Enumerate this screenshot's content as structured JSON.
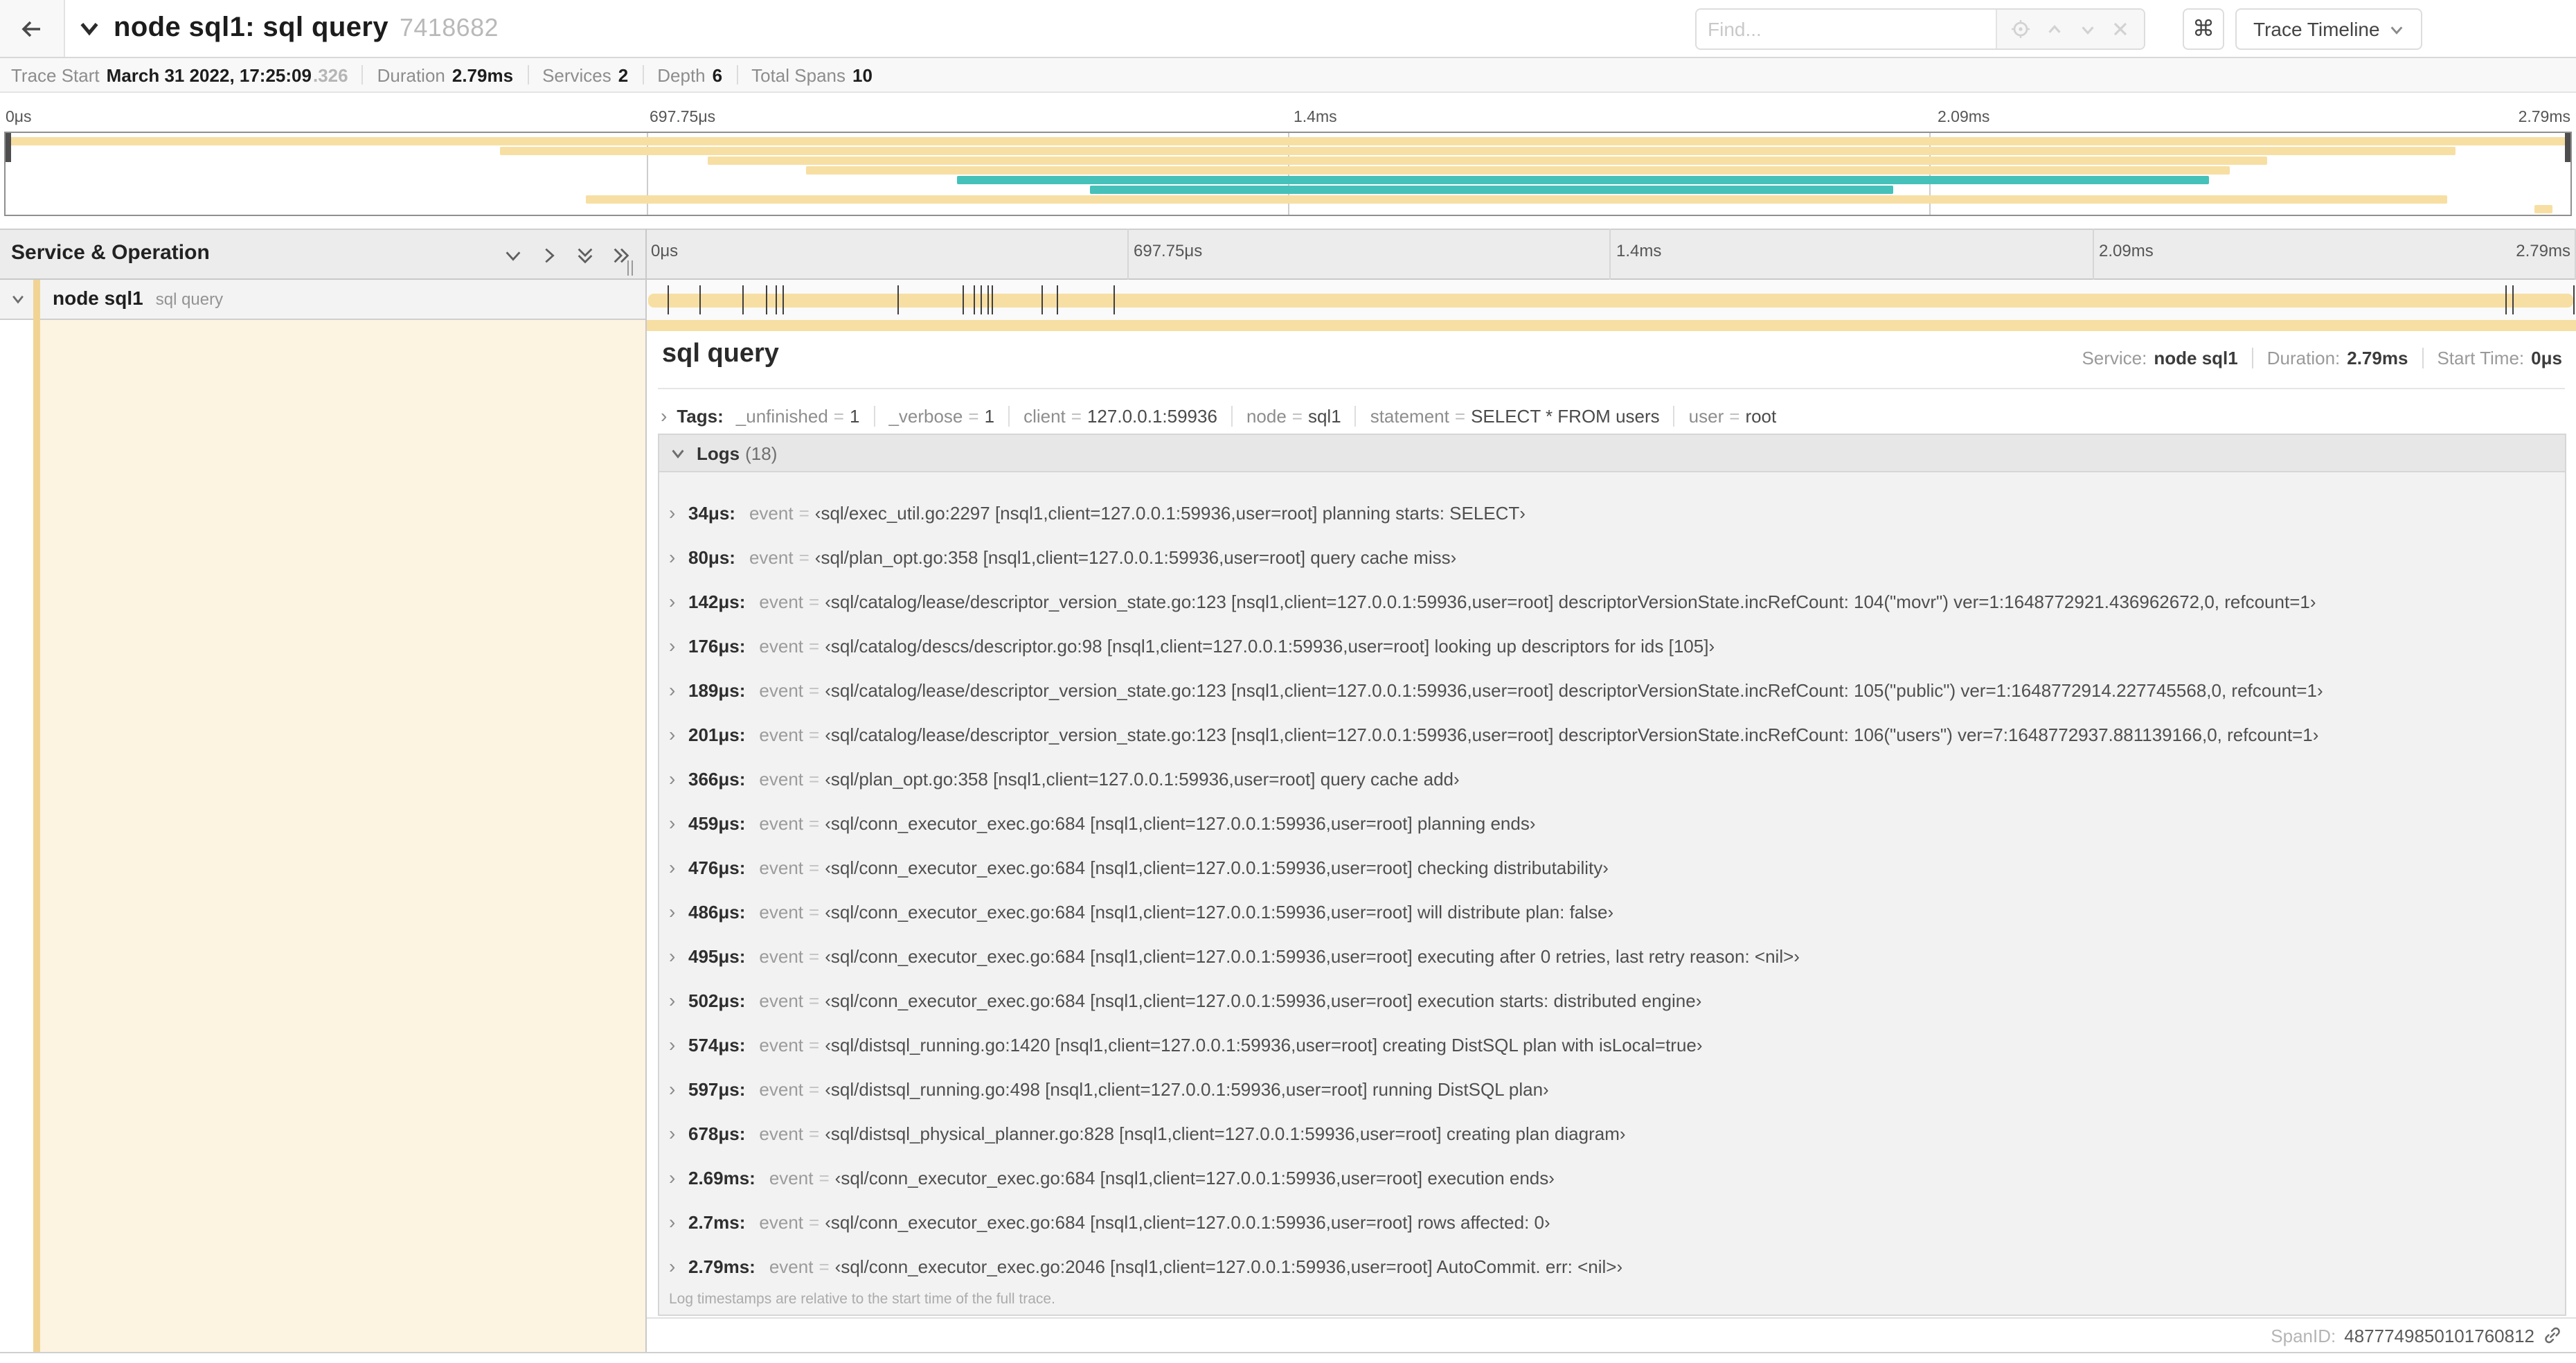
{
  "colors": {
    "span_tan": "#f7dfa3",
    "accent_tan": "#f1d494",
    "flow_teal": "#45c1ba",
    "left_column_cream": "#fcf3e1"
  },
  "header": {
    "title": "node sql1: sql query",
    "trace_id": "7418682",
    "find_placeholder": "Find...",
    "shortcut_key": "⌘",
    "view_button": "Trace Timeline"
  },
  "trace_info": {
    "items": [
      {
        "label": "Trace Start",
        "value": "March 31 2022, 17:25:09",
        "suffix": ".326"
      },
      {
        "label": "Duration",
        "value": "2.79ms"
      },
      {
        "label": "Services",
        "value": "2"
      },
      {
        "label": "Depth",
        "value": "6"
      },
      {
        "label": "Total Spans",
        "value": "10"
      }
    ]
  },
  "ruler": {
    "ticks": [
      {
        "label": "0μs",
        "pct": 0
      },
      {
        "label": "697.75μs",
        "pct": 25
      },
      {
        "label": "1.4ms",
        "pct": 50
      },
      {
        "label": "2.09ms",
        "pct": 75
      },
      {
        "label": "2.79ms",
        "pct": 100
      }
    ]
  },
  "minimap": {
    "bars": [
      {
        "row": 0,
        "start": 0,
        "end": 100,
        "color": "span_tan"
      },
      {
        "row": 1,
        "start": 19.3,
        "end": 95.5,
        "color": "span_tan"
      },
      {
        "row": 2,
        "start": 27.4,
        "end": 88.2,
        "color": "span_tan"
      },
      {
        "row": 3,
        "start": 31.2,
        "end": 86.7,
        "color": "span_tan"
      },
      {
        "row": 4,
        "start": 37.1,
        "end": 85.9,
        "color": "flow_teal"
      },
      {
        "row": 5,
        "start": 42.3,
        "end": 73.6,
        "color": "flow_teal"
      },
      {
        "row": 6,
        "start": 22.6,
        "end": 95.2,
        "color": "span_tan"
      },
      {
        "row": 7,
        "start": 98.6,
        "end": 99.3,
        "color": "span_tan"
      }
    ]
  },
  "timeline_header": {
    "label": "Service & Operation"
  },
  "span_row": {
    "service": "node sql1",
    "operation": "sql query",
    "tick_pcts": [
      1.2,
      2.9,
      5.1,
      6.3,
      6.8,
      7.2,
      13.1,
      16.5,
      17.1,
      17.4,
      17.8,
      18.0,
      20.6,
      21.4,
      24.3,
      96.4,
      96.8,
      99.93
    ]
  },
  "detail": {
    "title": "sql query",
    "summary": [
      {
        "label": "Service:",
        "value": "node sql1"
      },
      {
        "label": "Duration:",
        "value": "2.79ms"
      },
      {
        "label": "Start Time:",
        "value": "0μs"
      }
    ],
    "tags": {
      "label": "Tags:",
      "items": [
        {
          "key": "_unfinished",
          "value": "1"
        },
        {
          "key": "_verbose",
          "value": "1"
        },
        {
          "key": "client",
          "value": "127.0.0.1:59936"
        },
        {
          "key": "node",
          "value": "sql1"
        },
        {
          "key": "statement",
          "value": "SELECT * FROM users"
        },
        {
          "key": "user",
          "value": "root"
        }
      ]
    },
    "logs": {
      "label": "Logs",
      "count": "(18)",
      "field_key": "event",
      "entries": [
        {
          "t": "34μs:",
          "v": "‹sql/exec_util.go:2297 [nsql1,client=127.0.0.1:59936,user=root] planning starts: SELECT›"
        },
        {
          "t": "80μs:",
          "v": "‹sql/plan_opt.go:358 [nsql1,client=127.0.0.1:59936,user=root] query cache miss›"
        },
        {
          "t": "142μs:",
          "v": "‹sql/catalog/lease/descriptor_version_state.go:123 [nsql1,client=127.0.0.1:59936,user=root] descriptorVersionState.incRefCount: 104(\"movr\") ver=1:1648772921.436962672,0, refcount=1›"
        },
        {
          "t": "176μs:",
          "v": "‹sql/catalog/descs/descriptor.go:98 [nsql1,client=127.0.0.1:59936,user=root] looking up descriptors for ids [105]›"
        },
        {
          "t": "189μs:",
          "v": "‹sql/catalog/lease/descriptor_version_state.go:123 [nsql1,client=127.0.0.1:59936,user=root] descriptorVersionState.incRefCount: 105(\"public\") ver=1:1648772914.227745568,0, refcount=1›"
        },
        {
          "t": "201μs:",
          "v": "‹sql/catalog/lease/descriptor_version_state.go:123 [nsql1,client=127.0.0.1:59936,user=root] descriptorVersionState.incRefCount: 106(\"users\") ver=7:1648772937.881139166,0, refcount=1›"
        },
        {
          "t": "366μs:",
          "v": "‹sql/plan_opt.go:358 [nsql1,client=127.0.0.1:59936,user=root] query cache add›"
        },
        {
          "t": "459μs:",
          "v": "‹sql/conn_executor_exec.go:684 [nsql1,client=127.0.0.1:59936,user=root] planning ends›"
        },
        {
          "t": "476μs:",
          "v": "‹sql/conn_executor_exec.go:684 [nsql1,client=127.0.0.1:59936,user=root] checking distributability›"
        },
        {
          "t": "486μs:",
          "v": "‹sql/conn_executor_exec.go:684 [nsql1,client=127.0.0.1:59936,user=root] will distribute plan: false›"
        },
        {
          "t": "495μs:",
          "v": "‹sql/conn_executor_exec.go:684 [nsql1,client=127.0.0.1:59936,user=root] executing after 0 retries, last retry reason: <nil>›"
        },
        {
          "t": "502μs:",
          "v": "‹sql/conn_executor_exec.go:684 [nsql1,client=127.0.0.1:59936,user=root] execution starts: distributed engine›"
        },
        {
          "t": "574μs:",
          "v": "‹sql/distsql_running.go:1420 [nsql1,client=127.0.0.1:59936,user=root] creating DistSQL plan with isLocal=true›"
        },
        {
          "t": "597μs:",
          "v": "‹sql/distsql_running.go:498 [nsql1,client=127.0.0.1:59936,user=root] running DistSQL plan›"
        },
        {
          "t": "678μs:",
          "v": "‹sql/distsql_physical_planner.go:828 [nsql1,client=127.0.0.1:59936,user=root] creating plan diagram›"
        },
        {
          "t": "2.69ms:",
          "v": "‹sql/conn_executor_exec.go:684 [nsql1,client=127.0.0.1:59936,user=root] execution ends›"
        },
        {
          "t": "2.7ms:",
          "v": "‹sql/conn_executor_exec.go:684 [nsql1,client=127.0.0.1:59936,user=root] rows affected: 0›"
        },
        {
          "t": "2.79ms:",
          "v": "‹sql/conn_executor_exec.go:2046 [nsql1,client=127.0.0.1:59936,user=root] AutoCommit. err: <nil>›"
        }
      ],
      "note": "Log timestamps are relative to the start time of the full trace."
    },
    "footer": {
      "label": "SpanID:",
      "value": "4877749850101760812"
    }
  }
}
